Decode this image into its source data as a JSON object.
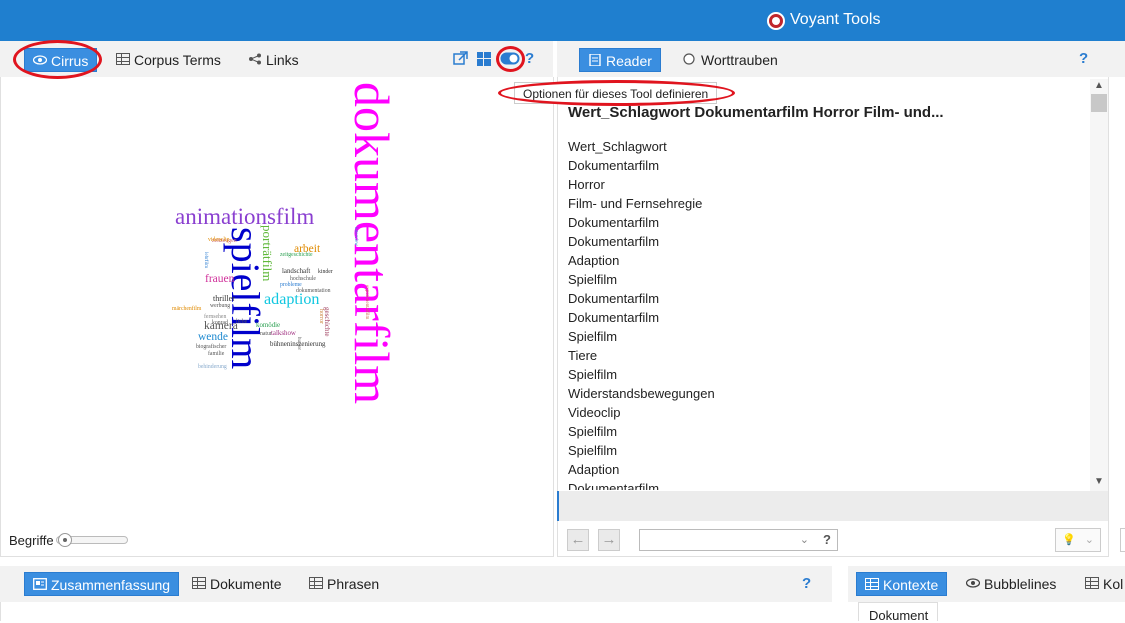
{
  "app": {
    "title": "Voyant Tools"
  },
  "left_toolbar": {
    "tabs": [
      {
        "label": "Cirrus",
        "icon": "eye-icon",
        "active": true
      },
      {
        "label": "Corpus Terms",
        "icon": "grid-icon",
        "active": false
      },
      {
        "label": "Links",
        "icon": "share-icon",
        "active": false
      }
    ],
    "icons": [
      "export-icon",
      "windows-icon",
      "toggle-options-icon",
      "help-icon"
    ],
    "help_label": "?"
  },
  "right_toolbar": {
    "tabs": [
      {
        "label": "Reader",
        "icon": "document-icon",
        "active": true
      },
      {
        "label": "Worttrauben",
        "icon": "radio-icon",
        "active": false
      }
    ],
    "help_label": "?"
  },
  "tooltip": "Optionen für dieses Tool definieren",
  "cirrus": {
    "slider_label": "Begriffe",
    "words": [
      {
        "text": "dokumentarfilm",
        "color": "#ff00ff"
      },
      {
        "text": "spielfilm",
        "color": "#0000cc"
      },
      {
        "text": "animationsfilm",
        "color": "#8a3fd0"
      },
      {
        "text": "adaption",
        "color": "#11c7e0"
      },
      {
        "text": "porträtfilm",
        "color": "#5fb83a"
      },
      {
        "text": "arbeit",
        "color": "#e08a00"
      },
      {
        "text": "frauen",
        "color": "#d0309a"
      },
      {
        "text": "kamera",
        "color": "#555555"
      },
      {
        "text": "wende",
        "color": "#1f8ad0"
      },
      {
        "text": "thriller",
        "color": "#333333"
      },
      {
        "text": "komödie",
        "color": "#2aa050"
      },
      {
        "text": "landschaft",
        "color": "#333333"
      },
      {
        "text": "hochschule",
        "color": "#555555"
      },
      {
        "text": "dokumentation",
        "color": "#555555"
      },
      {
        "text": "probleme",
        "color": "#2a7cd0"
      },
      {
        "text": "bühneninszenierung",
        "color": "#333333"
      },
      {
        "text": "talkshow",
        "color": "#a03080"
      },
      {
        "text": "familie",
        "color": "#555555"
      },
      {
        "text": "biografischer",
        "color": "#555555"
      },
      {
        "text": "märchenfilm",
        "color": "#e08a00"
      },
      {
        "text": "konrad",
        "color": "#555555"
      },
      {
        "text": "liebe",
        "color": "#555555"
      },
      {
        "text": "fernsehen",
        "color": "#888888"
      },
      {
        "text": "behinderung",
        "color": "#88aacc"
      },
      {
        "text": "zeitzeugen",
        "color": "#cc6666"
      },
      {
        "text": "kinder",
        "color": "#333333"
      },
      {
        "text": "interview",
        "color": "#1f8ad0"
      },
      {
        "text": "videoclip",
        "color": "#e08a00"
      },
      {
        "text": "lehrfilm",
        "color": "#2a7cd0"
      },
      {
        "text": "werbung",
        "color": "#555555"
      },
      {
        "text": "zeitgeschichte",
        "color": "#2aa050"
      },
      {
        "text": "experimentalfilm",
        "color": "#cc6644"
      },
      {
        "text": "humor",
        "color": "#555555"
      },
      {
        "text": "horror",
        "color": "#cc8844"
      },
      {
        "text": "natur",
        "color": "#555555"
      },
      {
        "text": "geschichte",
        "color": "#a04060"
      }
    ]
  },
  "reader": {
    "title": "Wert_Schlagwort Dokumentarfilm Horror Film- und...",
    "lines": [
      "Wert_Schlagwort",
      "Dokumentarfilm",
      "Horror",
      "Film- und Fernsehregie",
      "Dokumentarfilm",
      "Dokumentarfilm",
      "Adaption",
      "Spielfilm",
      "Dokumentarfilm",
      "Dokumentarfilm",
      "Spielfilm",
      "Tiere",
      "Spielfilm",
      "Widerstandsbewegungen",
      "Videoclip",
      "Spielfilm",
      "Spielfilm",
      "Adaption",
      "Dokumentarfilm"
    ],
    "search_placeholder": "",
    "help_label": "?"
  },
  "bottom_left_toolbar": {
    "tabs": [
      {
        "label": "Zusammenfassung",
        "icon": "summary-icon",
        "active": true
      },
      {
        "label": "Dokumente",
        "icon": "grid-icon",
        "active": false
      },
      {
        "label": "Phrasen",
        "icon": "grid-icon",
        "active": false
      }
    ],
    "help_label": "?"
  },
  "bottom_right_toolbar": {
    "tabs": [
      {
        "label": "Kontexte",
        "icon": "grid-icon",
        "active": true
      },
      {
        "label": "Bubblelines",
        "icon": "eye-icon",
        "active": false
      },
      {
        "label": "Kol",
        "icon": "grid-icon",
        "active": false
      }
    ],
    "column_header": "Dokument"
  }
}
